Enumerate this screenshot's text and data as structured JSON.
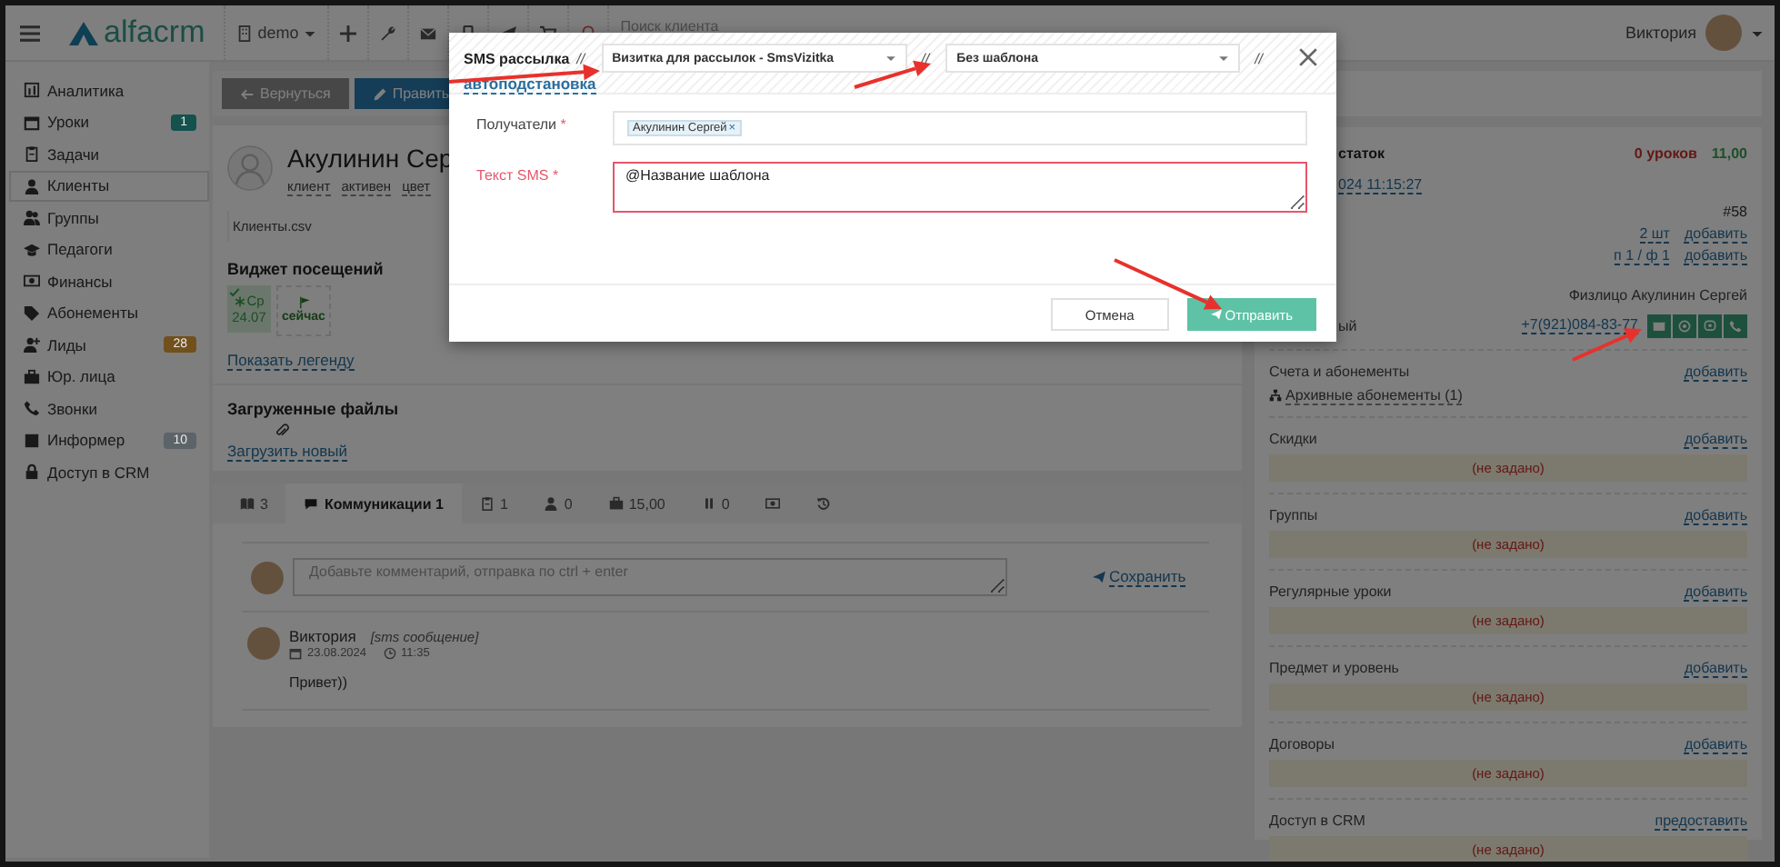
{
  "topbar": {
    "brand": "alfacrm",
    "branch": "demo",
    "search": {
      "placeholder": "Поиск клиента"
    },
    "user": "Виктория"
  },
  "sidebar": {
    "items": [
      {
        "label": "Аналитика",
        "selected": false
      },
      {
        "label": "Уроки",
        "badge": "1",
        "color": "#15514d",
        "selected": false
      },
      {
        "label": "Задачи",
        "selected": false
      },
      {
        "label": "Клиенты",
        "selected": true
      },
      {
        "label": "Группы",
        "selected": false
      },
      {
        "label": "Педагоги",
        "selected": false
      },
      {
        "label": "Финансы",
        "selected": false
      },
      {
        "label": "Абонементы",
        "selected": false
      },
      {
        "label": "Лиды",
        "badge": "28",
        "color": "#71501b",
        "selected": false
      },
      {
        "label": "Юр. лица",
        "selected": false
      },
      {
        "label": "Звонки",
        "selected": false
      },
      {
        "label": "Информер",
        "badge": "10",
        "color": "#5c6369",
        "selected": false
      },
      {
        "label": "Доступ в CRM",
        "selected": false
      }
    ]
  },
  "actions": [
    {
      "label": "Вернуться",
      "kind": "back"
    },
    {
      "label": "Править",
      "kind": "edit"
    }
  ],
  "client": {
    "name": "Акулинин Сер",
    "tags": [
      "клиент",
      "активен",
      "цвет"
    ],
    "file": "Клиенты.csv"
  },
  "visits_widget": {
    "title": "Виджет посещений",
    "cells": [
      {
        "kind": "visit",
        "day": "Ср",
        "date": "24.07"
      },
      {
        "kind": "now",
        "label": "сейчас"
      }
    ],
    "legend_link": "Показать легенду"
  },
  "files": {
    "title": "Загруженные файлы",
    "upload_link": "Загрузить новый"
  },
  "tabs": [
    {
      "label": "3",
      "selected": false
    },
    {
      "label": "Коммуникации 1",
      "selected": true
    },
    {
      "label": "1",
      "selected": false
    },
    {
      "label": "0",
      "selected": false
    },
    {
      "label": "15,00",
      "selected": false
    },
    {
      "label": "0",
      "selected": false
    },
    {
      "selected": false
    },
    {
      "selected": false
    }
  ],
  "comment_form": {
    "placeholder": "Добавьте комментарий, отправка по ctrl + enter",
    "save": "Сохранить"
  },
  "comments": [
    {
      "author": "Виктория",
      "type": "[sms сообщение]",
      "date": "23.08.2024",
      "time": "11:35",
      "text": "Привет))"
    }
  ],
  "details": {
    "balance_label": "статок",
    "lessons": "0 уроков",
    "balance": "11,00",
    "date": "024 11:15:27",
    "number": "#58",
    "rows": [
      {
        "value": "2 шт",
        "action": "добавить"
      },
      {
        "value": "п 1 / ф 1",
        "action": "добавить"
      }
    ],
    "legal": "Физлицо Акулинин Сергей",
    "phone_label": "ый",
    "phone": "+7(921)084-83-77"
  },
  "sections": [
    {
      "title": "Счета и абонементы",
      "action": "добавить",
      "link": "Архивные абонементы (1)"
    },
    {
      "title": "Скидки",
      "action": "добавить",
      "empty": "(не задано)"
    },
    {
      "title": "Группы",
      "action": "добавить",
      "empty": "(не задано)"
    },
    {
      "title": "Регулярные уроки",
      "action": "добавить",
      "empty": "(не задано)"
    },
    {
      "title": "Предмет и уровень",
      "action": "добавить",
      "empty": "(не задано)"
    },
    {
      "title": "Договоры",
      "action": "добавить",
      "empty": "(не задано)"
    },
    {
      "title": "Доступ в CRM",
      "action": "предоставить",
      "empty": "(не задано)"
    }
  ],
  "modal": {
    "title": "SMS рассылка",
    "separators": [
      "//",
      "//",
      "//"
    ],
    "provider": "Визитка для рассылок - SmsVizitka",
    "template": "Без шаблона",
    "autofill_link": "автоподстановка",
    "fields": [
      {
        "label": "Получатели",
        "mark": "*",
        "kind": "tags",
        "tags": [
          {
            "label": "Акулинин Сергей",
            "remove": "×"
          }
        ],
        "invalid": false
      },
      {
        "label": "Текст SMS",
        "mark": "*",
        "kind": "textarea",
        "value": "@Название шаблона",
        "invalid": true
      }
    ],
    "buttons": [
      {
        "label": "Отмена",
        "kind": "cancel"
      },
      {
        "label": "Отправить",
        "kind": "send"
      }
    ]
  }
}
